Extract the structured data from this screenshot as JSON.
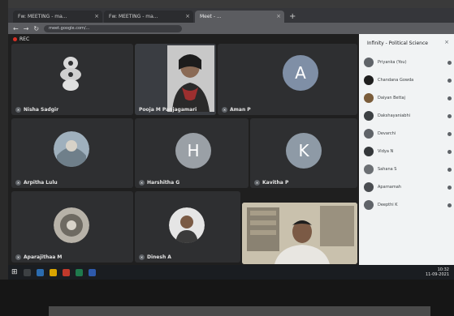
{
  "browser": {
    "tabs": [
      {
        "title": "Fw: MEETING - ma..."
      },
      {
        "title": "Fw: MEETING - ma..."
      },
      {
        "title": "Meet - ..."
      }
    ],
    "new_tab": "+",
    "url": "meet.google.com/..."
  },
  "meeting": {
    "recording_label": "REC",
    "tiles": [
      {
        "name": "Nisha Sadgir",
        "avatar": "logo"
      },
      {
        "name": "Pooja M Panjagamari",
        "avatar": "camera"
      },
      {
        "name": "Aman P",
        "avatar": "A",
        "color": "#7f8fa6"
      },
      {
        "name": "Arpitha Lulu",
        "avatar": "photo"
      },
      {
        "name": "Harshitha G",
        "avatar": "H",
        "color": "#9aa0a6"
      },
      {
        "name": "Kavitha P",
        "avatar": "K",
        "color": "#8e9aa6"
      },
      {
        "name": "Aparajithaa M",
        "avatar": "photo"
      },
      {
        "name": "Dinesh A",
        "avatar": "photo"
      },
      {
        "name": "",
        "avatar": "camera"
      }
    ]
  },
  "panel": {
    "title": "Infinity - Political Science",
    "close": "×",
    "participants": [
      {
        "name": "Priyanka (You)",
        "color": "#5f6368"
      },
      {
        "name": "Chandana Gowda",
        "color": "#1e1e1e"
      },
      {
        "name": "Daiyan Bettaj",
        "color": "#7a5c3a"
      },
      {
        "name": "Dakshayaniabhi",
        "color": "#3c4043"
      },
      {
        "name": "Devarchi",
        "color": "#5f6368"
      },
      {
        "name": "Vidya N",
        "color": "#34373a"
      },
      {
        "name": "Sahana S",
        "color": "#6b6f73"
      },
      {
        "name": "Aparnamah",
        "color": "#4a4d51"
      },
      {
        "name": "Deepthi K",
        "color": "#5f6368"
      }
    ]
  },
  "taskbar": {
    "start": "⊞",
    "time": "10:32",
    "date": "11-09-2021"
  }
}
